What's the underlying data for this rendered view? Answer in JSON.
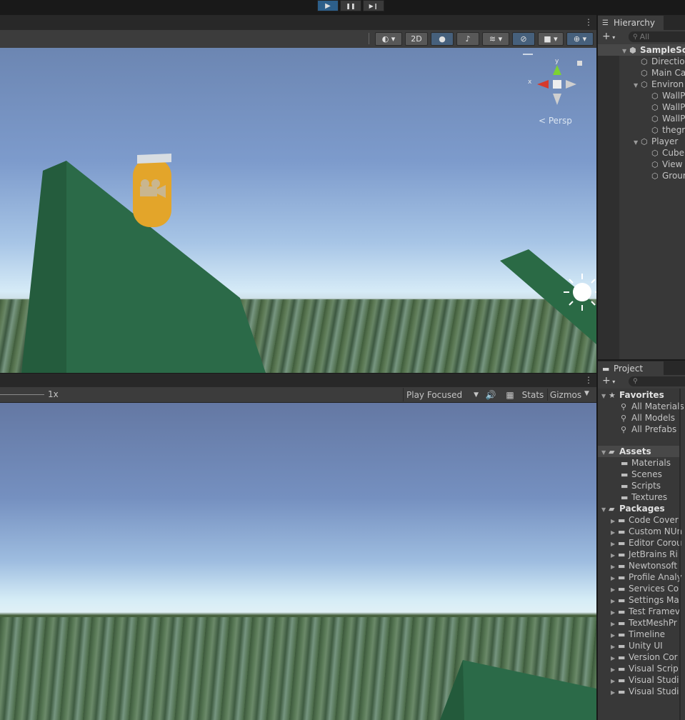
{
  "toolbar": {
    "play": "▶",
    "pause": "❚❚",
    "step": "▶❙"
  },
  "scene": {
    "mode_2d": "2D",
    "persp_label": "< Persp",
    "gizmo_y": "y",
    "gizmo_x": "x"
  },
  "game": {
    "scale": "1x",
    "play_mode": "Play Focused",
    "stats": "Stats",
    "gizmos": "Gizmos"
  },
  "hierarchy": {
    "tab": "Hierarchy",
    "search_placeholder": "All",
    "items": [
      {
        "label": "SampleSc"
      },
      {
        "label": "Directio"
      },
      {
        "label": "Main Ca"
      },
      {
        "label": "Environ"
      },
      {
        "label": "WallP"
      },
      {
        "label": "WallP"
      },
      {
        "label": "WallP"
      },
      {
        "label": "thegr"
      },
      {
        "label": "Player"
      },
      {
        "label": "Cube"
      },
      {
        "label": "View"
      },
      {
        "label": "Grour"
      }
    ]
  },
  "project": {
    "tab": "Project",
    "favorites": {
      "label": "Favorites",
      "items": [
        "All Materials",
        "All Models",
        "All Prefabs"
      ]
    },
    "assets": {
      "label": "Assets",
      "items": [
        "Materials",
        "Scenes",
        "Scripts",
        "Textures"
      ]
    },
    "packages": {
      "label": "Packages",
      "items": [
        "Code Cover",
        "Custom NUn",
        "Editor Corou",
        "JetBrains Ri",
        "Newtonsoft",
        "Profile Analy",
        "Services Co",
        "Settings Ma",
        "Test Framev",
        "TextMeshPr",
        "Timeline",
        "Unity UI",
        "Version Cor",
        "Visual Scrip",
        "Visual Studi",
        "Visual Studi"
      ]
    }
  }
}
